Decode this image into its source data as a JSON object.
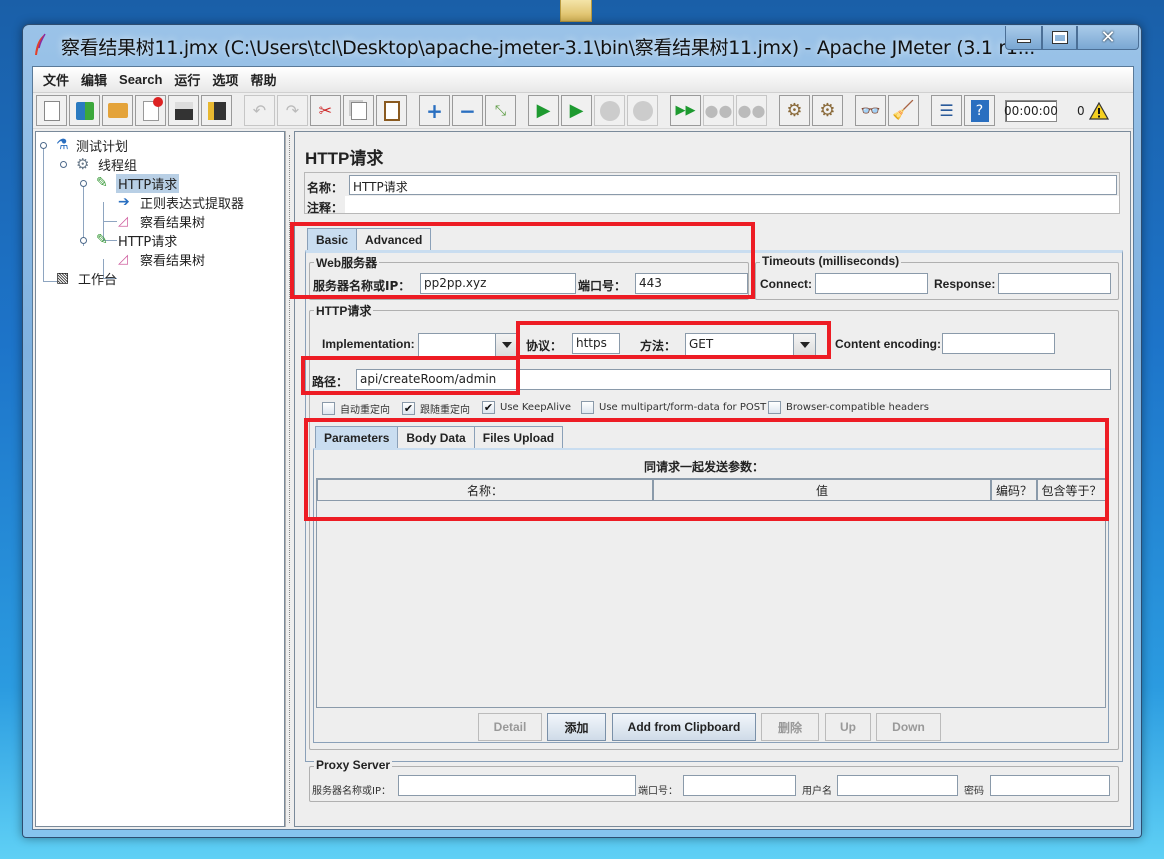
{
  "window": {
    "title": "察看结果树11.jmx (C:\\Users\\tcl\\Desktop\\apache-jmeter-3.1\\bin\\察看结果树11.jmx) - Apache JMeter (3.1 r1...",
    "controls": [
      "minimize",
      "maximize",
      "close"
    ]
  },
  "menu": [
    "文件",
    "编辑",
    "Search",
    "运行",
    "选项",
    "帮助"
  ],
  "toolbar": {
    "buttons": [
      {
        "icon": "new-icon",
        "enabled": true
      },
      {
        "icon": "templates-icon",
        "enabled": true
      },
      {
        "icon": "open-icon",
        "enabled": true
      },
      {
        "icon": "close-file-icon",
        "enabled": true
      },
      {
        "icon": "save-icon",
        "enabled": true
      },
      {
        "icon": "save-as-icon",
        "enabled": true
      },
      {
        "icon": "undo-icon",
        "enabled": false
      },
      {
        "icon": "redo-icon",
        "enabled": false
      },
      {
        "icon": "cut-icon",
        "enabled": true
      },
      {
        "icon": "copy-icon",
        "enabled": true
      },
      {
        "icon": "paste-icon",
        "enabled": true
      },
      {
        "icon": "expand-icon",
        "enabled": true
      },
      {
        "icon": "collapse-icon",
        "enabled": true
      },
      {
        "icon": "toggle-icon",
        "enabled": true
      },
      {
        "icon": "start-icon",
        "enabled": true
      },
      {
        "icon": "start-no-pause-icon",
        "enabled": true
      },
      {
        "icon": "stop-icon",
        "enabled": false
      },
      {
        "icon": "shutdown-icon",
        "enabled": false
      },
      {
        "icon": "remote-start-icon",
        "enabled": true
      },
      {
        "icon": "remote-stop-icon",
        "enabled": false
      },
      {
        "icon": "remote-shutdown-icon",
        "enabled": false
      },
      {
        "icon": "clear-icon",
        "enabled": true
      },
      {
        "icon": "clear-all-icon",
        "enabled": true
      },
      {
        "icon": "search-icon",
        "enabled": true
      },
      {
        "icon": "reset-search-icon",
        "enabled": true
      },
      {
        "icon": "function-helper-icon",
        "enabled": true
      },
      {
        "icon": "help-icon",
        "enabled": true
      }
    ],
    "timer": "00:00:00",
    "error_count": "0"
  },
  "tree": [
    {
      "label": "测试计划",
      "icon": "test-plan-icon",
      "level": 0
    },
    {
      "label": "线程组",
      "icon": "thread-group-icon",
      "level": 1
    },
    {
      "label": "HTTP请求",
      "icon": "http-sampler-icon",
      "level": 2,
      "selected": true
    },
    {
      "label": "正则表达式提取器",
      "icon": "regex-extractor-icon",
      "level": 3
    },
    {
      "label": "察看结果树",
      "icon": "results-tree-icon",
      "level": 3
    },
    {
      "label": "HTTP请求",
      "icon": "http-sampler-icon",
      "level": 2
    },
    {
      "label": "察看结果树",
      "icon": "results-tree-icon",
      "level": 3
    },
    {
      "label": "工作台",
      "icon": "workbench-icon",
      "level": 0
    }
  ],
  "panel": {
    "title": "HTTP请求",
    "name_label": "名称：",
    "name_value": "HTTP请求",
    "comment_label": "注释：",
    "comment_value": "",
    "tabs": [
      {
        "label": "Basic",
        "active": true
      },
      {
        "label": "Advanced",
        "active": false
      }
    ],
    "web_server": {
      "title": "Web服务器",
      "server_label": "服务器名称或IP：",
      "server_value": "pp2pp.xyz",
      "port_label": "端口号：",
      "port_value": "443"
    },
    "timeouts": {
      "title": "Timeouts (milliseconds)",
      "connect_label": "Connect:",
      "connect_value": "",
      "response_label": "Response:",
      "response_value": ""
    },
    "http_request": {
      "title": "HTTP请求",
      "implementation_label": "Implementation:",
      "implementation_value": "",
      "protocol_label": "协议：",
      "protocol_value": "https",
      "method_label": "方法：",
      "method_value": "GET",
      "encoding_label": "Content encoding:",
      "encoding_value": "",
      "path_label": "路径：",
      "path_value": "api/createRoom/admin",
      "checkboxes": [
        {
          "label": "自动重定向",
          "checked": false
        },
        {
          "label": "跟随重定向",
          "checked": true
        },
        {
          "label": "Use KeepAlive",
          "checked": true
        },
        {
          "label": "Use multipart/form-data for POST",
          "checked": false
        },
        {
          "label": "Browser-compatible headers",
          "checked": false
        }
      ]
    },
    "param_tabs": [
      {
        "label": "Parameters",
        "active": true
      },
      {
        "label": "Body Data",
        "active": false
      },
      {
        "label": "Files Upload",
        "active": false
      }
    ],
    "params_heading": "同请求一起发送参数：",
    "params_columns": [
      "名称：",
      "值",
      "编码？",
      "包含等于？"
    ],
    "params_rows": [],
    "buttons": [
      {
        "label": "Detail",
        "enabled": false
      },
      {
        "label": "添加",
        "enabled": true
      },
      {
        "label": "Add from Clipboard",
        "enabled": true
      },
      {
        "label": "删除",
        "enabled": false
      },
      {
        "label": "Up",
        "enabled": false
      },
      {
        "label": "Down",
        "enabled": false
      }
    ],
    "proxy": {
      "title": "Proxy Server",
      "server_label": "服务器名称或IP：",
      "server_value": "",
      "port_label": "端口号：",
      "port_value": "",
      "user_label": "用户名",
      "user_value": "",
      "password_label": "密码",
      "password_value": ""
    }
  },
  "annotation_color": "#ed1c24"
}
